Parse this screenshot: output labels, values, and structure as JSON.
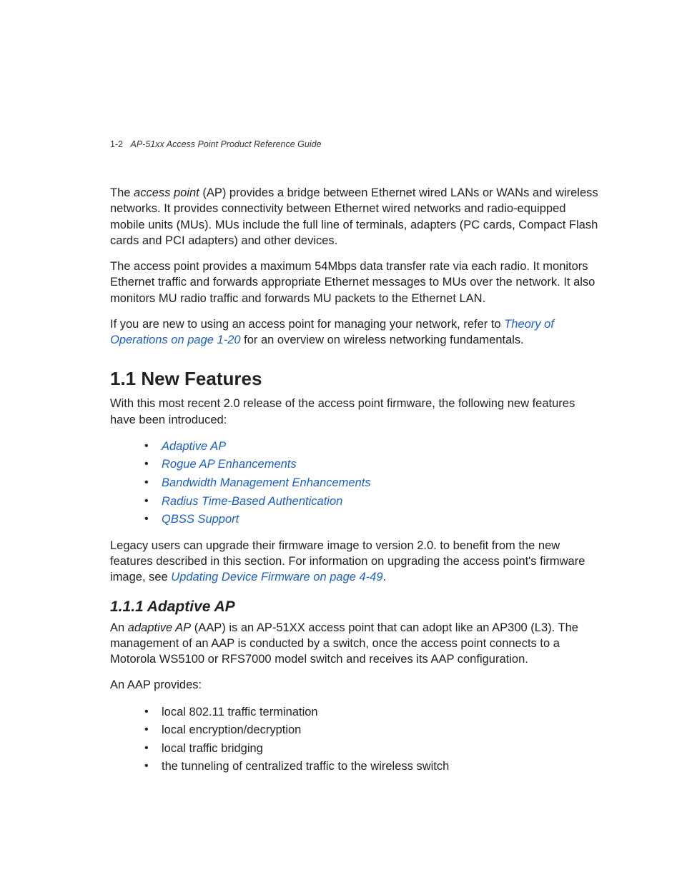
{
  "header": {
    "page_number": "1-2",
    "guide_title": "AP-51xx Access Point Product Reference Guide"
  },
  "intro": {
    "p1_prefix": "The ",
    "p1_term": "access point",
    "p1_rest": " (AP) provides a bridge between Ethernet wired LANs or WANs and wireless networks. It provides connectivity between Ethernet wired networks and radio-equipped mobile units (MUs). MUs include the full line of terminals, adapters (PC cards, Compact Flash cards and PCI adapters) and other devices.",
    "p2": "The access point provides a maximum 54Mbps data transfer rate via each radio. It monitors Ethernet traffic and forwards appropriate Ethernet messages to MUs over the network. It also monitors MU radio traffic and forwards MU packets to the Ethernet LAN.",
    "p3_prefix": "If you are new to using an access point for managing your network, refer to ",
    "p3_link": "Theory of Operations on page 1-20",
    "p3_rest": " for an overview on wireless networking fundamentals."
  },
  "section1": {
    "heading": "1.1 New Features",
    "lead": "With this most recent 2.0 release of the access point firmware, the following new features have been introduced:",
    "features": [
      "Adaptive AP",
      "Rogue AP Enhancements",
      "Bandwidth Management Enhancements",
      "Radius Time-Based Authentication",
      "QBSS Support"
    ],
    "legacy_prefix": "Legacy users can upgrade their firmware image to version 2.0. to benefit from the new features described in this section. For information on upgrading the access point's firmware image, see ",
    "legacy_link": "Updating Device Firmware on page 4-49",
    "legacy_suffix": "."
  },
  "section1_1_1": {
    "heading": "1.1.1 Adaptive AP",
    "p1_prefix": "An ",
    "p1_term": "adaptive AP",
    "p1_rest": " (AAP) is an AP-51XX access point that can adopt like an AP300 (L3). The management of an AAP is conducted by a switch, once the access point connects to a Motorola WS5100 or RFS7000 model switch and receives its AAP configuration.",
    "p2": "An AAP provides:",
    "bullets": [
      "local 802.11 traffic termination",
      "local encryption/decryption",
      "local traffic bridging",
      "the tunneling of centralized traffic to the wireless switch"
    ]
  }
}
